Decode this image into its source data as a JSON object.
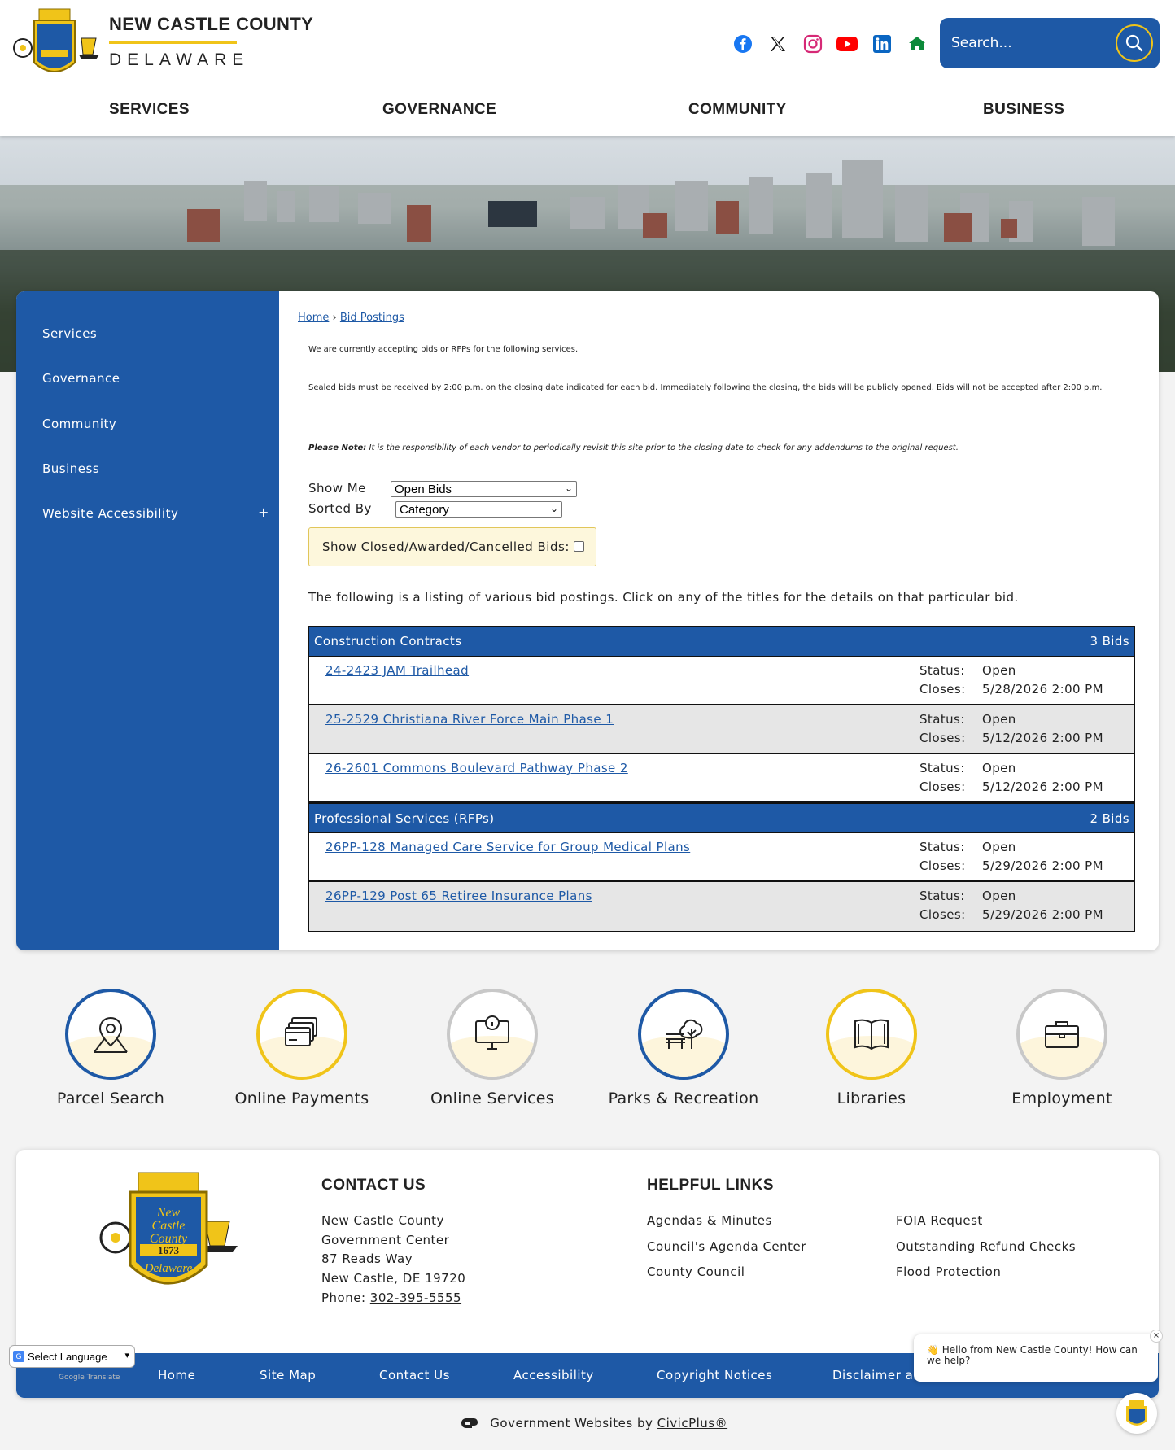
{
  "header": {
    "title": "NEW CASTLE COUNTY",
    "subtitle": "DELAWARE",
    "search_placeholder": "Search...",
    "seal": {
      "line1": "New",
      "line2": "Castle",
      "line3": "County",
      "year": "1673",
      "state": "Delaware"
    }
  },
  "social": [
    {
      "name": "facebook-icon",
      "color": "#1877f2"
    },
    {
      "name": "x-icon",
      "color": "#111111"
    },
    {
      "name": "instagram-icon",
      "color": "#d62976"
    },
    {
      "name": "youtube-icon",
      "color": "#ff0000"
    },
    {
      "name": "linkedin-icon",
      "color": "#0a66c2"
    },
    {
      "name": "nextdoor-icon",
      "color": "#0c8a3a"
    }
  ],
  "nav": {
    "services": "SERVICES",
    "governance": "GOVERNANCE",
    "community": "COMMUNITY",
    "business": "BUSINESS"
  },
  "sidebar": {
    "items": [
      "Services",
      "Governance",
      "Community",
      "Business",
      "Website Accessibility"
    ],
    "expand": "+"
  },
  "breadcrumb": {
    "home": "Home",
    "sep": "›",
    "current": "Bid Postings"
  },
  "content": {
    "intro1": "We are currently accepting bids or RFPs for the following services.",
    "intro2": "Sealed bids must be received by 2:00 p.m. on the closing date indicated for each bid. Immediately following the closing, the bids will be publicly opened. Bids will not be accepted after 2:00 p.m.",
    "note_label": "Please Note:",
    "note_text": "It is the responsibility of each vendor to periodically revisit this site prior to the closing date to check for any addendums to the original request.",
    "show_me_label": "Show Me",
    "show_me_value": "Open Bids",
    "sorted_by_label": "Sorted By",
    "sorted_by_value": "Category",
    "closed_label": "Show Closed/Awarded/Cancelled Bids:",
    "listing_text": "The following is a listing of various bid postings. Click on any of the titles for the details on that particular bid."
  },
  "bid_categories": [
    {
      "name": "Construction Contracts",
      "count": "3 Bids",
      "bids": [
        {
          "title": "24-2423 JAM Trailhead",
          "status_label": "Status:",
          "status": "Open",
          "closes_label": "Closes:",
          "closes": "5/28/2026 2:00 PM"
        },
        {
          "title": "25-2529 Christiana River Force Main Phase 1",
          "status_label": "Status:",
          "status": "Open",
          "closes_label": "Closes:",
          "closes": "5/12/2026 2:00 PM"
        },
        {
          "title": "26-2601 Commons Boulevard Pathway Phase 2",
          "status_label": "Status:",
          "status": "Open",
          "closes_label": "Closes:",
          "closes": "5/12/2026 2:00 PM"
        }
      ]
    },
    {
      "name": "Professional Services (RFPs)",
      "count": "2 Bids",
      "bids": [
        {
          "title": "26PP-128 Managed Care Service for Group Medical Plans",
          "status_label": "Status:",
          "status": "Open",
          "closes_label": "Closes:",
          "closes": "5/29/2026 2:00 PM"
        },
        {
          "title": "26PP-129 Post 65 Retiree Insurance Plans",
          "status_label": "Status:",
          "status": "Open",
          "closes_label": "Closes:",
          "closes": "5/29/2026 2:00 PM"
        }
      ]
    }
  ],
  "quick_links": [
    {
      "label": "Parcel Search",
      "ring": "#1e59a6"
    },
    {
      "label": "Online Payments",
      "ring": "#f0c419"
    },
    {
      "label": "Online Services",
      "ring": "#c8c8c8"
    },
    {
      "label": "Parks & Recreation",
      "ring": "#1e59a6"
    },
    {
      "label": "Libraries",
      "ring": "#f0c419"
    },
    {
      "label": "Employment",
      "ring": "#c8c8c8"
    }
  ],
  "footer": {
    "contact_heading": "CONTACT US",
    "address": [
      "New Castle County",
      "Government Center",
      "87 Reads Way",
      "New Castle, DE 19720"
    ],
    "phone_label": "Phone: ",
    "phone": "302-395-5555",
    "links_heading": "HELPFUL LINKS",
    "links_col1": [
      "Agendas & Minutes",
      "Council's Agenda Center",
      "County Council"
    ],
    "links_col2": [
      "FOIA Request",
      "Outstanding Refund Checks",
      "Flood Protection"
    ],
    "bottom_nav": [
      "Home",
      "Site Map",
      "Contact Us",
      "Accessibility",
      "Copyright Notices",
      "Disclaimer ar"
    ],
    "civic_prefix": "Government Websites by ",
    "civic_link": "CivicPlus®"
  },
  "translate": {
    "label": "Select Language",
    "powered": "Google Translate"
  },
  "chat": {
    "message": "👋 Hello from New Castle County! How can we help?",
    "close": "×"
  },
  "colors": {
    "primary": "#1e59a6",
    "accent": "#f0c419",
    "link": "#1e59a6"
  }
}
